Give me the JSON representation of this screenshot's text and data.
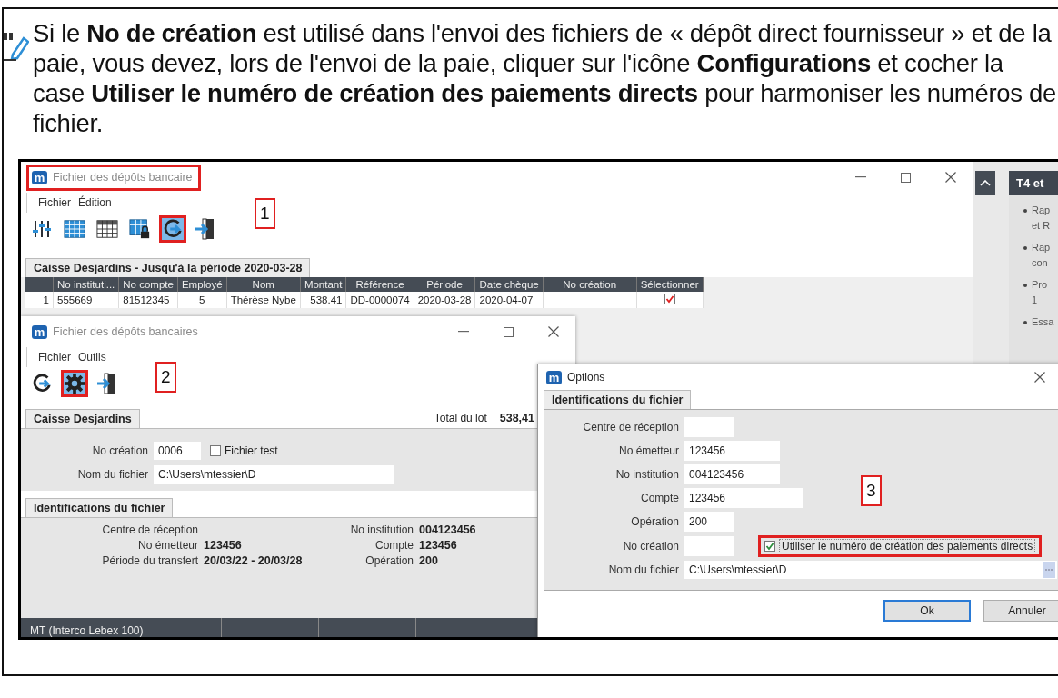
{
  "note": {
    "text": "Si le **No de création** est utilisé dans l'envoi des fichiers de « dépôt direct fournisseur » et de la paie, vous devez, lors de l'envoi de la paie, cliquer sur l'icône **Configurations** et cocher la case **Utiliser le numéro de création des paiements directs** pour harmoniser les numéros de fichier."
  },
  "screenshot": {
    "list_window": {
      "logo": "m",
      "title": "Fichier des dépôts bancaire",
      "title_highlighted": true,
      "menu": [
        "Fichier",
        "Édition"
      ],
      "toolbar": [
        {
          "kind": "sliders",
          "highlighted": false
        },
        {
          "kind": "grid",
          "highlighted": false
        },
        {
          "kind": "grid-outline",
          "highlighted": false
        },
        {
          "kind": "grid-lock",
          "highlighted": false
        },
        {
          "kind": "refresh",
          "highlighted": true
        },
        {
          "kind": "exit",
          "highlighted": false
        }
      ],
      "callout": "1",
      "tab": "Caisse Desjardins - Jusqu'à la période 2020-03-28",
      "columns": [
        "No instituti...",
        "No compte",
        "Employé",
        "Nom",
        "Montant",
        "Référence",
        "Période",
        "Date chèque",
        "No création",
        "Sélectionner"
      ],
      "rows": [
        {
          "number": "1",
          "values": [
            "555669",
            "81512345",
            "5",
            "Thérèse Nybe",
            "538.41",
            "DD-0000074",
            "2020-03-28",
            "2020-04-07"
          ],
          "checked": true
        }
      ]
    },
    "side_panel": {
      "heading": "T4 et",
      "items": [
        {
          "lines": [
            "Rap",
            "et R"
          ]
        },
        {
          "lines": [
            "Rap",
            "con"
          ]
        },
        {
          "lines": [
            "Pro",
            "1"
          ]
        },
        {
          "lines": [
            "Essa"
          ]
        }
      ]
    },
    "settings_window": {
      "logo": "m",
      "title": "Fichier des dépôts bancaires",
      "menu": [
        "Fichier",
        "Outils"
      ],
      "toolbar": [
        {
          "kind": "refresh",
          "highlighted": false
        },
        {
          "kind": "gear",
          "highlighted": true
        },
        {
          "kind": "exit",
          "highlighted": false
        }
      ],
      "callout": "2",
      "tab": "Caisse Desjardins",
      "total_label": "Total du lot",
      "total": "538,41",
      "no_creation": {
        "label": "No création",
        "value": "0006"
      },
      "test_file": {
        "label": "Fichier test",
        "checked": false
      },
      "file_name": {
        "label": "Nom du fichier",
        "value": "C:\\Users\\mtessier\\D"
      },
      "id_tab": "Identifications du fichier",
      "id_left": [
        {
          "label": "Centre de réception"
        },
        {
          "label": "No émetteur",
          "value": "123456"
        },
        {
          "label": "Période du transfert",
          "value": "20/03/22 - 20/03/28"
        }
      ],
      "id_right": [
        {
          "label": "No institution",
          "value": "004123456"
        },
        {
          "label": "Compte",
          "value": "123456"
        },
        {
          "label": "Opération",
          "value": "200"
        }
      ],
      "status_bar": [
        "MT (Interco Lebex 100)"
      ]
    },
    "options_dialog": {
      "logo": "m",
      "title": "Options",
      "tab": "Identifications du fichier",
      "fields": [
        {
          "label": "Centre de réception",
          "kind": "short"
        },
        {
          "label": "No émetteur",
          "value": "123456",
          "kind": "medium"
        },
        {
          "label": "No institution",
          "value": "004123456",
          "kind": "medium"
        },
        {
          "label": "Compte",
          "value": "123456",
          "kind": "wide"
        },
        {
          "label": "Opération",
          "value": "200",
          "kind": "short"
        },
        {
          "label": "No création",
          "kind": "short"
        },
        {
          "label": "Nom du fichier",
          "value": "C:\\Users\\mtessier\\D",
          "kind": "file"
        }
      ],
      "use_direct_number": {
        "label": "Utiliser le numéro de création des paiements directs",
        "checked": true,
        "highlighted": true
      },
      "callout": "3",
      "buttons": [
        {
          "label": "Ok",
          "default": true
        },
        {
          "label": "Annuler",
          "default": false
        }
      ]
    }
  }
}
